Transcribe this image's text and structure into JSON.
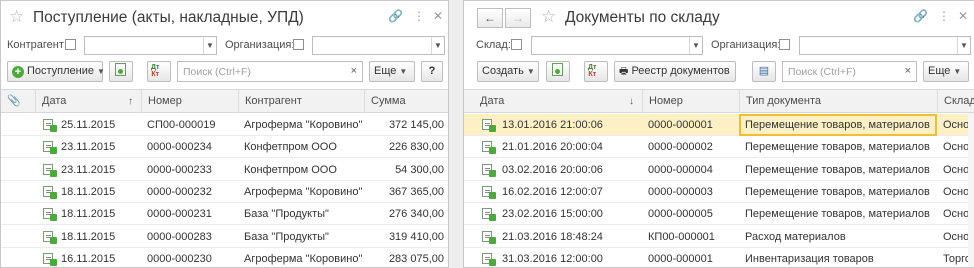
{
  "left": {
    "title": "Поступление (акты, накладные, УПД)",
    "icons": {
      "star": "star-icon",
      "link": "link-icon",
      "more": "more-vertical-icon",
      "close": "close-icon"
    },
    "filters": {
      "counterparty_label": "Контрагент:",
      "organization_label": "Организация:"
    },
    "toolbar": {
      "create_label": "Поступление",
      "search_placeholder": "Поиск (Ctrl+F)",
      "more_label": "Еще",
      "help_label": "?"
    },
    "columns": [
      "Дата",
      "Номер",
      "Контрагент",
      "Сумма"
    ],
    "rows": [
      {
        "date": "25.11.2015",
        "number": "СП00-000019",
        "counterparty": "Агроферма \"Коровино\"",
        "sum": "372 145,00"
      },
      {
        "date": "23.11.2015",
        "number": "0000-000234",
        "counterparty": "Конфетпром ООО",
        "sum": "226 830,00"
      },
      {
        "date": "23.11.2015",
        "number": "0000-000233",
        "counterparty": "Конфетпром ООО",
        "sum": "54 300,00"
      },
      {
        "date": "18.11.2015",
        "number": "0000-000232",
        "counterparty": "Агроферма \"Коровино\"",
        "sum": "367 365,00"
      },
      {
        "date": "18.11.2015",
        "number": "0000-000231",
        "counterparty": "База \"Продукты\"",
        "sum": "276 340,00"
      },
      {
        "date": "18.11.2015",
        "number": "0000-000283",
        "counterparty": "База \"Продукты\"",
        "sum": "319 410,00"
      },
      {
        "date": "16.11.2015",
        "number": "0000-000230",
        "counterparty": "Агроферма \"Коровино\"",
        "sum": "283 075,00"
      }
    ]
  },
  "right": {
    "title": "Документы по складу",
    "nav": {
      "back": "←",
      "forward": "→"
    },
    "filters": {
      "warehouse_label": "Склад:",
      "organization_label": "Организация:"
    },
    "toolbar": {
      "create_label": "Создать",
      "registry_label": "Реестр документов",
      "search_placeholder": "Поиск (Ctrl+F)",
      "more_label": "Еще"
    },
    "columns": [
      "Дата",
      "Номер",
      "Тип документа",
      "Склад"
    ],
    "rows": [
      {
        "date": "13.01.2016 21:00:06",
        "number": "0000-000001",
        "type": "Перемещение товаров, материалов",
        "warehouse": "Основ"
      },
      {
        "date": "21.01.2016 20:00:04",
        "number": "0000-000002",
        "type": "Перемещение товаров, материалов",
        "warehouse": "Основ"
      },
      {
        "date": "03.02.2016 20:00:06",
        "number": "0000-000004",
        "type": "Перемещение товаров, материалов",
        "warehouse": "Основ"
      },
      {
        "date": "16.02.2016 12:00:07",
        "number": "0000-000003",
        "type": "Перемещение товаров, материалов",
        "warehouse": "Основ"
      },
      {
        "date": "23.02.2016 15:00:00",
        "number": "0000-000005",
        "type": "Перемещение товаров, материалов",
        "warehouse": "Основ"
      },
      {
        "date": "21.03.2016 18:48:24",
        "number": "КП00-000001",
        "type": "Расход материалов",
        "warehouse": "Основ"
      },
      {
        "date": "31.03.2016 12:00:00",
        "number": "0000-000001",
        "type": "Инвентаризация товаров",
        "warehouse": "Торгов"
      }
    ]
  },
  "colors": {
    "selected_row": "#fcf0c4",
    "selected_cell_border": "#f0bd36",
    "accent_green": "#4caa3c"
  }
}
